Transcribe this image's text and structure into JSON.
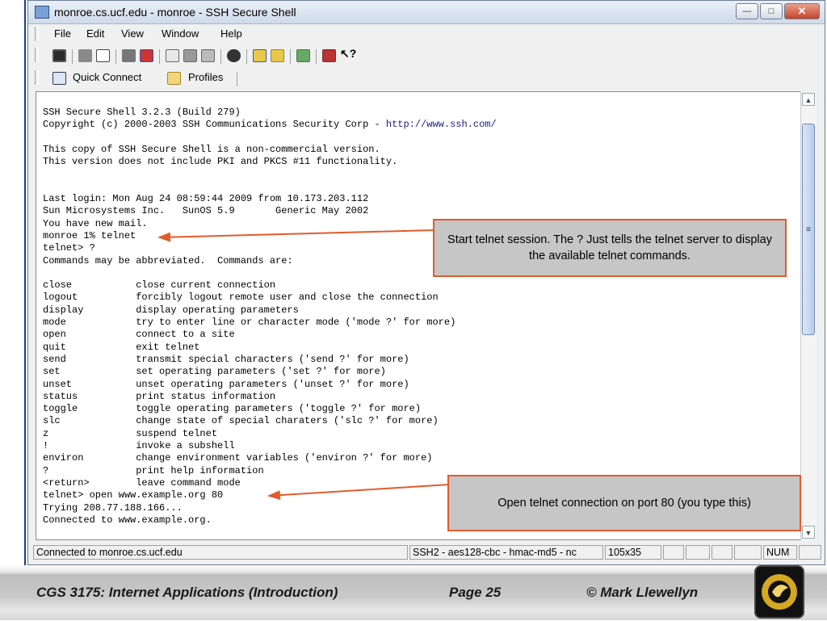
{
  "window": {
    "title": "monroe.cs.ucf.edu - monroe - SSH Secure Shell"
  },
  "menu": {
    "items": [
      "File",
      "Edit",
      "View",
      "Window",
      "Help"
    ]
  },
  "toolbar": {
    "quick_connect_label": "Quick Connect",
    "profiles_label": "Profiles"
  },
  "terminal": {
    "lines": [
      "SSH Secure Shell 3.2.3 (Build 279)",
      "Copyright (c) 2000-2003 SSH Communications Security Corp - http://www.ssh.com/",
      "",
      "This copy of SSH Secure Shell is a non-commercial version.",
      "This version does not include PKI and PKCS #11 functionality.",
      "",
      "",
      "Last login: Mon Aug 24 08:59:44 2009 from 10.173.203.112",
      "Sun Microsystems Inc.   SunOS 5.9       Generic May 2002",
      "You have new mail.",
      "monroe 1% telnet",
      "telnet> ?",
      "Commands may be abbreviated.  Commands are:",
      "",
      "close           close current connection",
      "logout          forcibly logout remote user and close the connection",
      "display         display operating parameters",
      "mode            try to enter line or character mode ('mode ?' for more)",
      "open            connect to a site",
      "quit            exit telnet",
      "send            transmit special characters ('send ?' for more)",
      "set             set operating parameters ('set ?' for more)",
      "unset           unset operating parameters ('unset ?' for more)",
      "status          print status information",
      "toggle          toggle operating parameters ('toggle ?' for more)",
      "slc             change state of special charaters ('slc ?' for more)",
      "z               suspend telnet",
      "!               invoke a subshell",
      "environ         change environment variables ('environ ?' for more)",
      "?               print help information",
      "<return>        leave command mode",
      "telnet> open www.example.org 80",
      "Trying 208.77.188.166...",
      "Connected to www.example.org."
    ]
  },
  "status": {
    "connection": "Connected to monroe.cs.ucf.edu",
    "cipher": "SSH2 - aes128-cbc - hmac-md5 - nc",
    "size": "105x35",
    "num": "NUM"
  },
  "callouts": {
    "telnet": "Start telnet session.  The ? Just tells the telnet server to display the available telnet commands.",
    "open": "Open telnet connection on port 80 (you type this)"
  },
  "footer": {
    "course": "CGS 3175: Internet Applications (Introduction)",
    "page": "Page 25",
    "author": "© Mark Llewellyn"
  },
  "colors": {
    "callout_border": "#e35b2b",
    "callout_fill": "#c6c6c6",
    "link": "#1a1a8a"
  }
}
